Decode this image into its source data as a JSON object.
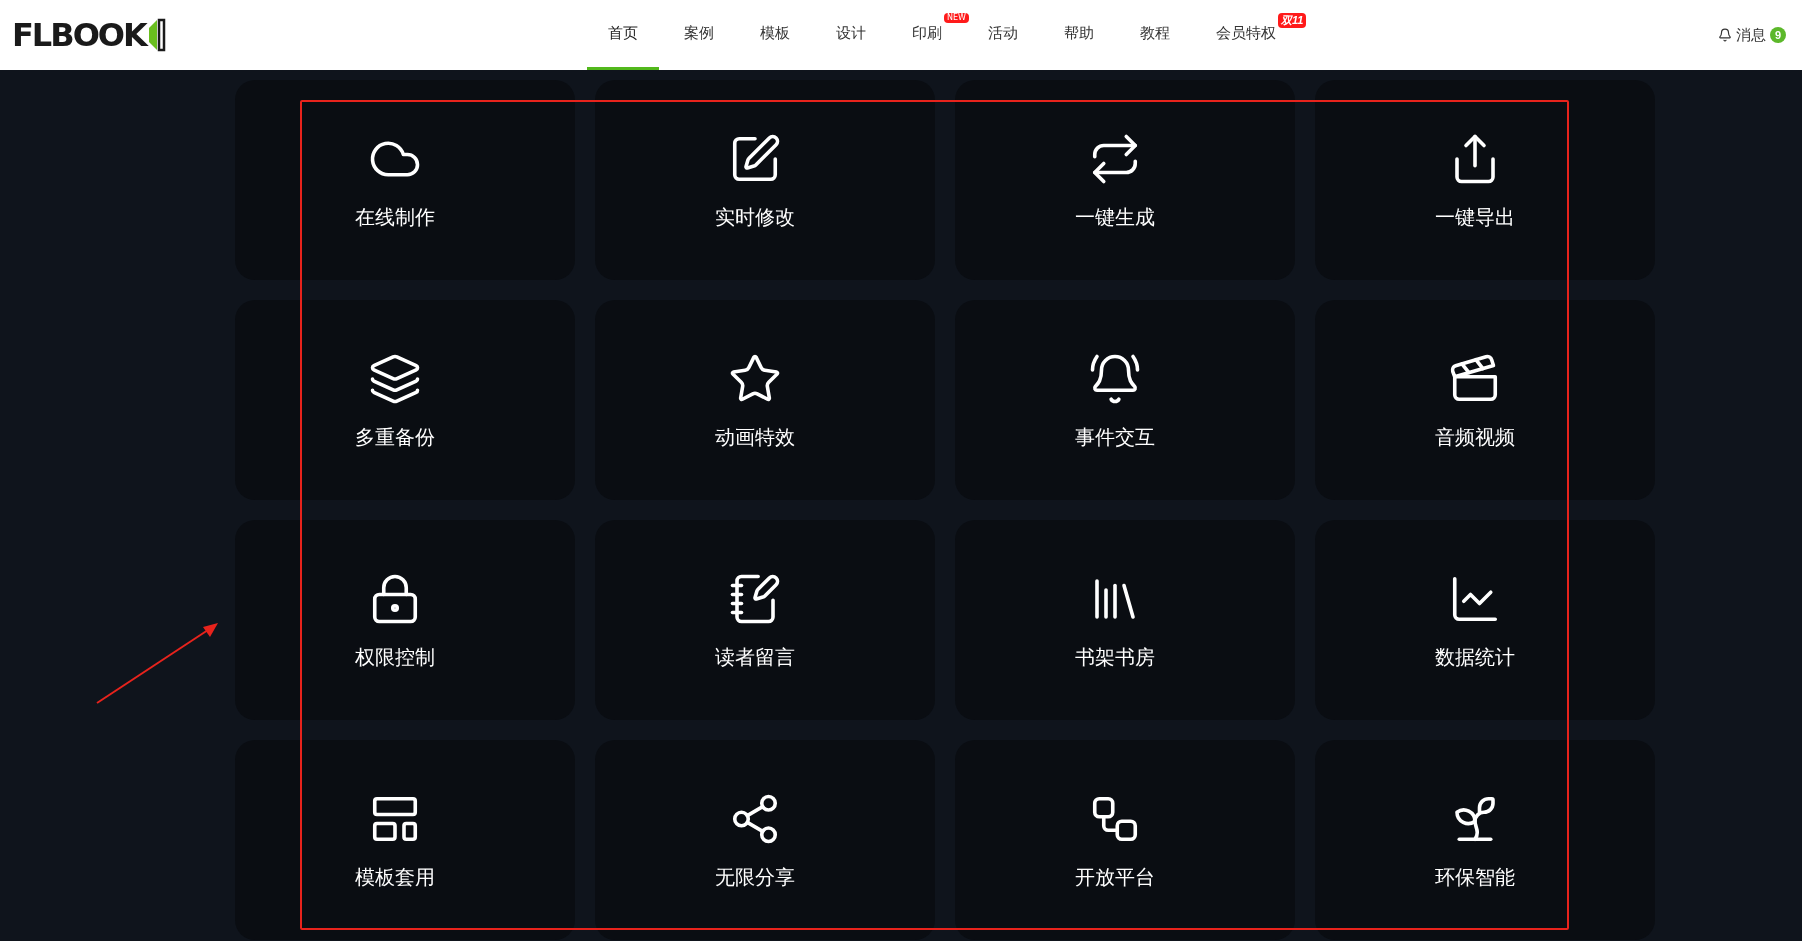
{
  "header": {
    "logo": "FLBOOK",
    "nav": [
      {
        "label": "首页",
        "selected": true
      },
      {
        "label": "案例",
        "selected": false
      },
      {
        "label": "模板",
        "selected": false
      },
      {
        "label": "设计",
        "selected": false
      },
      {
        "label": "印刷",
        "selected": false,
        "badge": "NEW"
      },
      {
        "label": "活动",
        "selected": false
      },
      {
        "label": "帮助",
        "selected": false
      },
      {
        "label": "教程",
        "selected": false
      },
      {
        "label": "会员特权",
        "selected": false,
        "badge": "双11"
      }
    ],
    "messages": {
      "label": "消息",
      "count": "9"
    }
  },
  "features": [
    {
      "label": "在线制作"
    },
    {
      "label": "实时修改"
    },
    {
      "label": "一键生成"
    },
    {
      "label": "一键导出"
    },
    {
      "label": "多重备份"
    },
    {
      "label": "动画特效"
    },
    {
      "label": "事件交互"
    },
    {
      "label": "音频视频"
    },
    {
      "label": "权限控制"
    },
    {
      "label": "读者留言"
    },
    {
      "label": "书架书房"
    },
    {
      "label": "数据统计"
    },
    {
      "label": "模板套用"
    },
    {
      "label": "无限分享"
    },
    {
      "label": "开放平台"
    },
    {
      "label": "环保智能"
    }
  ]
}
